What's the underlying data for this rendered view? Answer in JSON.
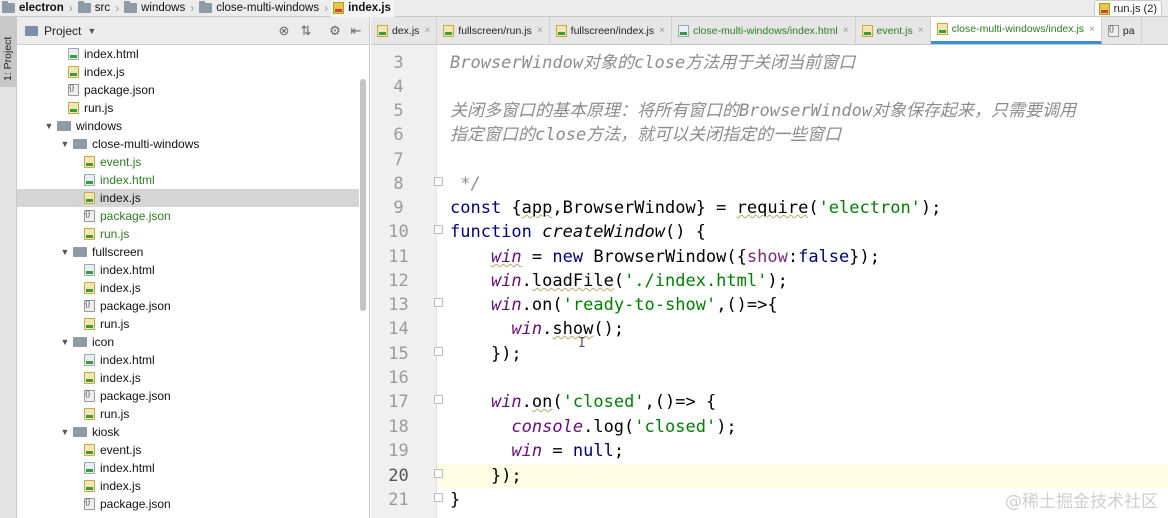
{
  "navbar": {
    "crumbs": [
      "electron",
      "src",
      "windows",
      "close-multi-windows",
      "index.js"
    ],
    "run_config": "run.js (2)"
  },
  "left_stripe": {
    "tab_label": "1: Project"
  },
  "project_panel": {
    "title": "Project",
    "tree": [
      {
        "label": "index.html",
        "type": "html",
        "depth": 2,
        "green": false
      },
      {
        "label": "index.js",
        "type": "js",
        "depth": 2,
        "green": false
      },
      {
        "label": "package.json",
        "type": "json",
        "depth": 2,
        "green": false
      },
      {
        "label": "run.js",
        "type": "js",
        "depth": 2,
        "green": false
      },
      {
        "label": "windows",
        "type": "folder",
        "depth": 1,
        "green": false,
        "expanded": true
      },
      {
        "label": "close-multi-windows",
        "type": "folder",
        "depth": 2,
        "green": false,
        "expanded": true
      },
      {
        "label": "event.js",
        "type": "js",
        "depth": 3,
        "green": true
      },
      {
        "label": "index.html",
        "type": "html",
        "depth": 3,
        "green": true
      },
      {
        "label": "index.js",
        "type": "js",
        "depth": 3,
        "green": false,
        "selected": true
      },
      {
        "label": "package.json",
        "type": "json",
        "depth": 3,
        "green": true
      },
      {
        "label": "run.js",
        "type": "js",
        "depth": 3,
        "green": true
      },
      {
        "label": "fullscreen",
        "type": "folder",
        "depth": 2,
        "green": false,
        "expanded": true
      },
      {
        "label": "index.html",
        "type": "html",
        "depth": 3,
        "green": false
      },
      {
        "label": "index.js",
        "type": "js",
        "depth": 3,
        "green": false
      },
      {
        "label": "package.json",
        "type": "json",
        "depth": 3,
        "green": false
      },
      {
        "label": "run.js",
        "type": "js",
        "depth": 3,
        "green": false
      },
      {
        "label": "icon",
        "type": "folder",
        "depth": 2,
        "green": false,
        "expanded": true
      },
      {
        "label": "index.html",
        "type": "html",
        "depth": 3,
        "green": false
      },
      {
        "label": "index.js",
        "type": "js",
        "depth": 3,
        "green": false
      },
      {
        "label": "package.json",
        "type": "json",
        "depth": 3,
        "green": false
      },
      {
        "label": "run.js",
        "type": "js",
        "depth": 3,
        "green": false
      },
      {
        "label": "kiosk",
        "type": "folder",
        "depth": 2,
        "green": false,
        "expanded": true
      },
      {
        "label": "event.js",
        "type": "js",
        "depth": 3,
        "green": false
      },
      {
        "label": "index.html",
        "type": "html",
        "depth": 3,
        "green": false
      },
      {
        "label": "index.js",
        "type": "js",
        "depth": 3,
        "green": false
      },
      {
        "label": "package.json",
        "type": "json",
        "depth": 3,
        "green": false
      }
    ]
  },
  "tabs": [
    {
      "label": "dex.js",
      "type": "js",
      "green": false,
      "active": false
    },
    {
      "label": "fullscreen/run.js",
      "type": "js",
      "green": false,
      "active": false
    },
    {
      "label": "fullscreen/index.js",
      "type": "js",
      "green": false,
      "active": false
    },
    {
      "label": "close-multi-windows/index.html",
      "type": "html",
      "green": true,
      "active": false
    },
    {
      "label": "event.js",
      "type": "js",
      "green": true,
      "active": false
    },
    {
      "label": "close-multi-windows/index.js",
      "type": "js",
      "green": true,
      "active": true
    },
    {
      "label": "pa",
      "type": "json",
      "green": false,
      "active": false
    }
  ],
  "editor": {
    "line_numbers": [
      "3",
      "4",
      "5",
      "6",
      "7",
      "8",
      "9",
      "10",
      "11",
      "12",
      "13",
      "14",
      "15",
      "16",
      "17",
      "18",
      "19",
      "20",
      "21"
    ],
    "current_line": "20",
    "comment_line3": "BrowserWindow对象的close方法用于关闭当前窗口",
    "comment_line5": "关闭多窗口的基本原理：将所有窗口的BrowserWindow对象保存起来，只需要调用",
    "comment_line6": "指定窗口的close方法，就可以关闭指定的一些窗口",
    "comment_line8": " */",
    "code9_kw": "const ",
    "code9_brace_open": "{",
    "code9_app": "app",
    "code9_comma": ",",
    "code9_bw": "BrowserWindow",
    "code9_brace_close": "} = ",
    "code9_require": "require",
    "code9_paren_open": "(",
    "code9_str": "'electron'",
    "code9_end": ");",
    "code10_kw": "function ",
    "code10_fn": "createWindow",
    "code10_rest": "() {",
    "code11_win": "win",
    "code11_eq": " = ",
    "code11_new": "new ",
    "code11_bw": "BrowserWindow",
    "code11_open": "({",
    "code11_show": "show",
    "code11_colon": ":",
    "code11_false": "false",
    "code11_close": "});",
    "code12_win": "win",
    "code12_dot": ".",
    "code12_method": "loadFile",
    "code12_open": "(",
    "code12_str": "'./index.html'",
    "code12_close": ");",
    "code13_win": "win",
    "code13_dot": ".",
    "code13_method": "on",
    "code13_open": "(",
    "code13_str": "'ready-to-show'",
    "code13_rest": ",()=>{",
    "code14_win": "win",
    "code14_dot": ".",
    "code14_method": "show",
    "code14_close": "();",
    "code15": "});",
    "code17_win": "win",
    "code17_dot": ".",
    "code17_method": "on",
    "code17_open": "(",
    "code17_str": "'closed'",
    "code17_rest": ",()=> {",
    "code18_console": "console",
    "code18_dot": ".",
    "code18_log": "log",
    "code18_open": "(",
    "code18_str": "'closed'",
    "code18_close": ");",
    "code19_win": "win",
    "code19_eq": " = ",
    "code19_null": "null",
    "code19_semi": ";",
    "code20": "});",
    "code21": "}"
  },
  "cursor_glyph": "I",
  "watermark": "@稀土掘金技术社区"
}
